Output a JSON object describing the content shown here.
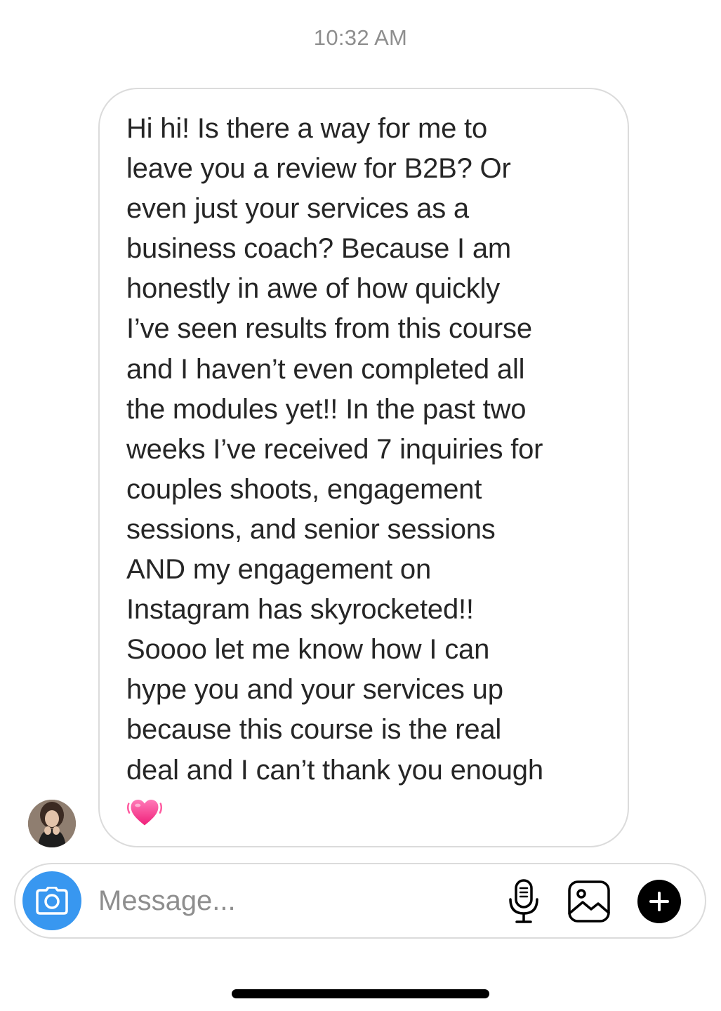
{
  "thread": {
    "timestamp": "10:32 AM",
    "message": {
      "text": "Hi hi! Is there a way for me to\nleave you a review for B2B? Or\neven just your services as a\nbusiness coach? Because I am\nhonestly in awe of how quickly\nI’ve seen results from this course\nand I haven’t even completed all\nthe modules yet!! In the past two\nweeks I’ve received 7 inquiries for\ncouples shoots, engagement\nsessions, and senior sessions\nAND my engagement on\nInstagram has skyrocketed!!\nSoooo let me know how I can\nhype you and your services up\nbecause this course is the real\ndeal and I can’t thank you enough",
      "emoji_icon": "beating-heart-icon"
    }
  },
  "composer": {
    "placeholder": "Message...",
    "camera_icon": "camera-icon",
    "mic_icon": "microphone-icon",
    "gallery_icon": "image-gallery-icon",
    "plus_icon": "plus-icon"
  },
  "colors": {
    "accent": "#3897f0",
    "bubble_border": "#dbdbdb",
    "text": "#262626",
    "muted": "#8e8e8e",
    "heart": "#ff3d8b"
  }
}
